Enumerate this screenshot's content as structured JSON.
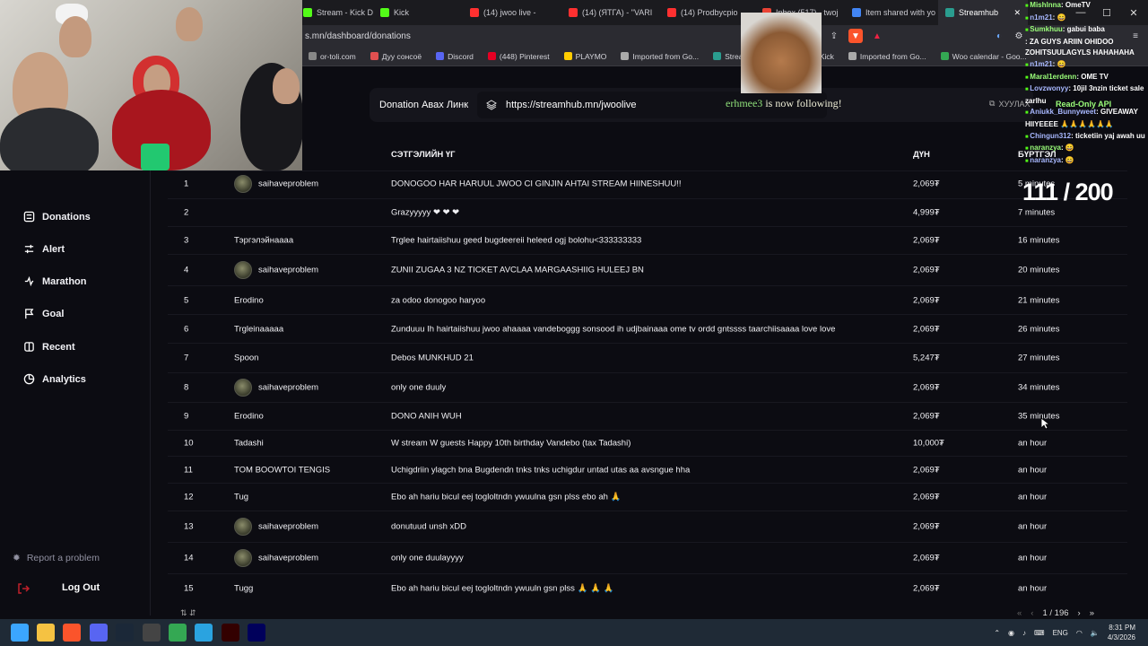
{
  "browser": {
    "tabs": [
      {
        "label": "Stream - Kick Dashb",
        "color": "#53fc18"
      },
      {
        "label": "Kick",
        "color": "#53fc18"
      },
      {
        "label": "(14) jwoo live -",
        "color": "#ff3030"
      },
      {
        "label": "(14) (ЯТГА) - \"VARI",
        "color": "#ff3030"
      },
      {
        "label": "(14) Prodbycpio",
        "color": "#ff3030"
      },
      {
        "label": "Inbox (517) - twoj",
        "color": "#ea4335"
      },
      {
        "label": "Item shared with yo",
        "color": "#4285f4"
      },
      {
        "label": "Streamhub",
        "color": "#2a9d8f",
        "active": true
      }
    ],
    "url": "s.mn/dashboard/donations",
    "bookmarks": [
      {
        "label": "or-toli.com",
        "color": "#888888"
      },
      {
        "label": "Дуу сонсоё",
        "color": "#e05050"
      },
      {
        "label": "Discord",
        "color": "#5865f2"
      },
      {
        "label": "(448) Pinterest",
        "color": "#e60023"
      },
      {
        "label": "PLAYMO",
        "color": "#ffcc00"
      },
      {
        "label": "Imported from Go...",
        "color": "#aaaaaa"
      },
      {
        "label": "Streamhub",
        "color": "#2a9d8f"
      },
      {
        "label": "D",
        "color": "#aaaaaa"
      },
      {
        "label": "Kick",
        "color": "#53fc18"
      },
      {
        "label": "Imported from Go...",
        "color": "#aaaaaa"
      },
      {
        "label": "Woo calendar - Goo...",
        "color": "#34a853"
      }
    ]
  },
  "donation_link": {
    "label": "Donation Авах Линк",
    "url": "https://streamhub.mn/jwoolive",
    "share_label": "ХУУЛАХ"
  },
  "follow_alert": {
    "name": "erhmee3",
    "text": "is now following!"
  },
  "counter": "111 / 200",
  "sidebar": {
    "items": [
      {
        "label": "Donations",
        "icon": "donations-icon"
      },
      {
        "label": "Alert",
        "icon": "alert-icon"
      },
      {
        "label": "Marathon",
        "icon": "marathon-icon"
      },
      {
        "label": "Goal",
        "icon": "goal-icon"
      },
      {
        "label": "Recent",
        "icon": "recent-icon"
      },
      {
        "label": "Analytics",
        "icon": "analytics-icon"
      }
    ],
    "report": "Report a problem",
    "logout": "Log Out"
  },
  "table": {
    "headers": {
      "message": "СЭТГЭЛИЙН ҮГ",
      "amount": "ДҮН",
      "time": "БҮРТГЭЛ"
    },
    "rows": [
      {
        "id": "1",
        "name": "saihaveproblem",
        "avatar": true,
        "message": "DONOGOO HAR HARUUL JWOO CI GINJIN AHTAI STREAM HIINESHUU!!",
        "amount": "2,069₮",
        "time": "5 minutes"
      },
      {
        "id": "2",
        "name": "",
        "avatar": false,
        "message": "Grazyyyyy ❤ ❤ ❤",
        "amount": "4,999₮",
        "time": "7 minutes"
      },
      {
        "id": "3",
        "name": "Тэргэлэйнаааа",
        "avatar": false,
        "message": "Trglee hairtaiishuu geed bugdeereii heleed ogj bolohu<333333333",
        "amount": "2,069₮",
        "time": "16 minutes"
      },
      {
        "id": "4",
        "name": "saihaveproblem",
        "avatar": true,
        "message": "ZUNII ZUGAA 3 NZ TICKET AVCLAA MARGAASHIIG HULEEJ BN",
        "amount": "2,069₮",
        "time": "20 minutes"
      },
      {
        "id": "5",
        "name": "Erodino",
        "avatar": false,
        "message": "za odoo donogoo haryoo",
        "amount": "2,069₮",
        "time": "21 minutes"
      },
      {
        "id": "6",
        "name": "Trgleinaaaaa",
        "avatar": false,
        "message": "Zunduuu Ih hairtaiishuu jwoo ahaaaa vandeboggg sonsood ih udjbainaaa ome tv ordd gntssss taarchiisaaaa love love",
        "amount": "2,069₮",
        "time": "26 minutes"
      },
      {
        "id": "7",
        "name": "Spoon",
        "avatar": false,
        "message": "Debos MUNKHUD 21",
        "amount": "5,247₮",
        "time": "27 minutes"
      },
      {
        "id": "8",
        "name": "saihaveproblem",
        "avatar": true,
        "message": "only one duuly",
        "amount": "2,069₮",
        "time": "34 minutes"
      },
      {
        "id": "9",
        "name": "Erodino",
        "avatar": false,
        "message": "DONO ANIH WUH",
        "amount": "2,069₮",
        "time": "35 minutes"
      },
      {
        "id": "10",
        "name": "Tadashi",
        "avatar": false,
        "message": "W stream W guests Happy 10th birthday Vandebo (tax Tadashi)",
        "amount": "10,000₮",
        "time": "an hour"
      },
      {
        "id": "11",
        "name": "TOM BOOWTOI TENGIS",
        "avatar": false,
        "message": "Uchigdriin ylagch bna Bugdendn tnks tnks uchigdur untad utas aa avsngue hha",
        "amount": "2,069₮",
        "time": "an hour"
      },
      {
        "id": "12",
        "name": "Tug",
        "avatar": false,
        "message": "Ebo ah hariu bicul eej togloltndn ywuulna gsn plss ebo ah 🙏",
        "amount": "2,069₮",
        "time": "an hour"
      },
      {
        "id": "13",
        "name": "saihaveproblem",
        "avatar": true,
        "message": "donutuud unsh xDD",
        "amount": "2,069₮",
        "time": "an hour"
      },
      {
        "id": "14",
        "name": "saihaveproblem",
        "avatar": true,
        "message": "only one duulayyyy",
        "amount": "2,069₮",
        "time": "an hour"
      },
      {
        "id": "15",
        "name": "Tugg",
        "avatar": false,
        "message": "Ebo ah hariu bicul eej togloltndn ywuuln gsn plss 🙏 🙏 🙏",
        "amount": "2,069₮",
        "time": "an hour"
      }
    ]
  },
  "pagination": {
    "label": "1 / 196"
  },
  "chat": [
    {
      "user": "Mishlnna",
      "text": ": OmeTV"
    },
    {
      "user": "n1m21",
      "text": ": 😄"
    },
    {
      "user": "Sumkhuu",
      "text": ": gabui baba"
    },
    {
      "user": "",
      "text": ": ZA GUYS ARIIN OHIDOO"
    },
    {
      "user": "",
      "text": "ZOHITSUULAGYLS HAHAHAHA"
    },
    {
      "user": "n1m21",
      "text": ": 😄"
    },
    {
      "user": "Maral1erdenn",
      "text": ": OME TV"
    },
    {
      "user": "Lovzwonyy",
      "text": ": 10jil 3nzin ticket sale"
    },
    {
      "user": "",
      "text": "zarlhu"
    },
    {
      "user": "Aniukk_Bunnyweet",
      "text": ": GIVEAWAY"
    },
    {
      "user": "",
      "text": "HIIYEEEE 🙏🙏🙏🙏🙏🙏"
    },
    {
      "user": "Chingun312",
      "text": ": ticketiin yaj awah uu"
    },
    {
      "user": "naranzya",
      "text": ": 😄"
    },
    {
      "user": "naranzya",
      "text": ": 😄"
    }
  ],
  "read_only": "Read-Only API",
  "taskbar": {
    "apps": [
      {
        "name": "windows-start-icon",
        "color": "#3ba6ff"
      },
      {
        "name": "file-explorer-icon",
        "color": "#f5c242"
      },
      {
        "name": "brave-icon",
        "color": "#fb542b"
      },
      {
        "name": "discord-icon",
        "color": "#5865f2"
      },
      {
        "name": "steam-icon",
        "color": "#1b2838"
      },
      {
        "name": "obs-icon",
        "color": "#444444"
      },
      {
        "name": "chrome-icon",
        "color": "#34a853"
      },
      {
        "name": "telegram-icon",
        "color": "#2aa3e0"
      },
      {
        "name": "illustrator-icon",
        "color": "#330000"
      },
      {
        "name": "premiere-icon",
        "color": "#00005b"
      }
    ],
    "lang": "ENG",
    "time": "8:31 PM",
    "date": "4/3/2026"
  }
}
